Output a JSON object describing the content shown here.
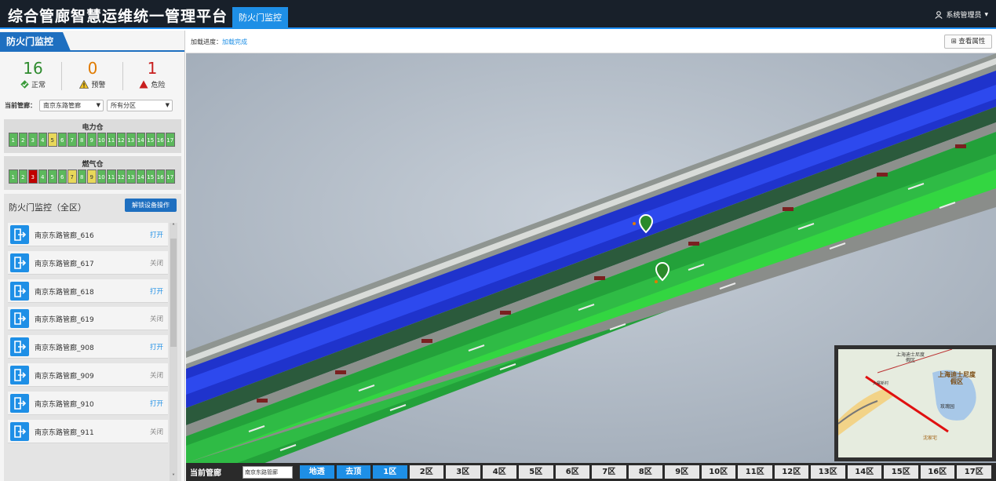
{
  "header": {
    "app_title": "综合管廊智慧运维统一管理平台",
    "active_tab": "防火门监控",
    "user": "系统管理员"
  },
  "left_panel": {
    "title": "防火门监控",
    "stats": [
      {
        "value": "16",
        "label": "正常",
        "color": "#2e8b2e",
        "icon": "diamond-check-icon"
      },
      {
        "value": "0",
        "label": "预警",
        "color": "#e07b00",
        "icon": "warning-triangle-icon"
      },
      {
        "value": "1",
        "label": "危险",
        "color": "#c81e1e",
        "icon": "danger-triangle-icon"
      }
    ],
    "pipe_label": "当前管廊：",
    "pipe_select": "南京东路管廊",
    "zone_select": "所有分区",
    "cabins": [
      {
        "title": "电力仓",
        "cells": [
          {
            "n": "1",
            "s": "g"
          },
          {
            "n": "2",
            "s": "g"
          },
          {
            "n": "3",
            "s": "g"
          },
          {
            "n": "4",
            "s": "g"
          },
          {
            "n": "5",
            "s": "y"
          },
          {
            "n": "6",
            "s": "g"
          },
          {
            "n": "7",
            "s": "g"
          },
          {
            "n": "8",
            "s": "g"
          },
          {
            "n": "9",
            "s": "g"
          },
          {
            "n": "10",
            "s": "g"
          },
          {
            "n": "11",
            "s": "g"
          },
          {
            "n": "12",
            "s": "g"
          },
          {
            "n": "13",
            "s": "g"
          },
          {
            "n": "14",
            "s": "g"
          },
          {
            "n": "15",
            "s": "g"
          },
          {
            "n": "16",
            "s": "g"
          },
          {
            "n": "17",
            "s": "g"
          }
        ]
      },
      {
        "title": "燃气仓",
        "cells": [
          {
            "n": "1",
            "s": "g"
          },
          {
            "n": "2",
            "s": "g"
          },
          {
            "n": "3",
            "s": "r"
          },
          {
            "n": "4",
            "s": "g"
          },
          {
            "n": "5",
            "s": "g"
          },
          {
            "n": "6",
            "s": "g"
          },
          {
            "n": "7",
            "s": "y"
          },
          {
            "n": "8",
            "s": "g"
          },
          {
            "n": "9",
            "s": "y"
          },
          {
            "n": "10",
            "s": "g"
          },
          {
            "n": "11",
            "s": "g"
          },
          {
            "n": "12",
            "s": "g"
          },
          {
            "n": "13",
            "s": "g"
          },
          {
            "n": "14",
            "s": "g"
          },
          {
            "n": "15",
            "s": "g"
          },
          {
            "n": "16",
            "s": "g"
          },
          {
            "n": "17",
            "s": "g"
          }
        ]
      }
    ],
    "status_colors": {
      "g": "#5cb85c",
      "y": "#e8d85a",
      "r": "#c00000"
    },
    "list_title": "防火门监控（全区）",
    "unlock_button": "解锁设备操作",
    "doors": [
      {
        "name": "南京东路管廊_616",
        "status": "打开",
        "open": true
      },
      {
        "name": "南京东路管廊_617",
        "status": "关闭",
        "open": false
      },
      {
        "name": "南京东路管廊_618",
        "status": "打开",
        "open": true
      },
      {
        "name": "南京东路管廊_619",
        "status": "关闭",
        "open": false
      },
      {
        "name": "南京东路管廊_908",
        "status": "打开",
        "open": true
      },
      {
        "name": "南京东路管廊_909",
        "status": "关闭",
        "open": false
      },
      {
        "name": "南京东路管廊_910",
        "status": "打开",
        "open": true
      },
      {
        "name": "南京东路管廊_911",
        "status": "关闭",
        "open": false
      }
    ]
  },
  "info_bar": {
    "progress_label": "加载进度：",
    "progress_value": "加载完成",
    "props_button": "查看属性"
  },
  "minimap": {
    "labels": [
      "上海迪士尼度假区",
      "上海迪士尼度假区",
      "玫瑰园",
      "沈家宅",
      "大寨新村"
    ]
  },
  "bottom_bar": {
    "label": "当前管廊",
    "select": "南京东路管廊",
    "buttons": [
      "地透",
      "去顶",
      "1区",
      "2区",
      "3区",
      "4区",
      "5区",
      "6区",
      "7区",
      "8区",
      "9区",
      "10区",
      "11区",
      "12区",
      "13区",
      "14区",
      "15区",
      "16区",
      "17区"
    ],
    "active": [
      0,
      1,
      2
    ]
  }
}
